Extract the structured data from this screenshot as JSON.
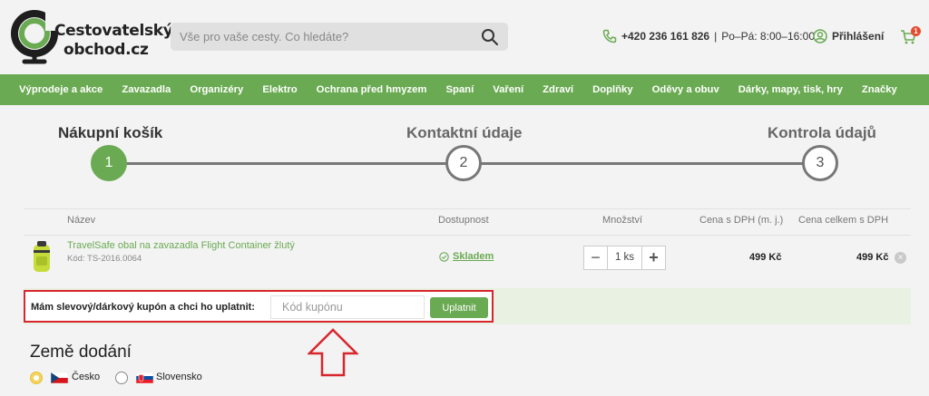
{
  "header": {
    "logo_line1": "Cestovatelský",
    "logo_line2": "obchod.cz",
    "search_placeholder": "Vše pro vaše cesty. Co hledáte?",
    "phone": "+420 236 161 826",
    "hours": "Po–Pá: 8:00–16:00",
    "login": "Přihlášení",
    "cart_count": "1"
  },
  "nav": {
    "items": [
      "Výprodeje a akce",
      "Zavazadla",
      "Organizéry",
      "Elektro",
      "Ochrana před hmyzem",
      "Spaní",
      "Vaření",
      "Zdraví",
      "Doplňky",
      "Oděvy a obuv",
      "Dárky, mapy, tisk, hry",
      "Značky"
    ]
  },
  "steps": [
    {
      "label": "Nákupní košík",
      "number": "1"
    },
    {
      "label": "Kontaktní údaje",
      "number": "2"
    },
    {
      "label": "Kontrola údajů",
      "number": "3"
    }
  ],
  "table": {
    "headers": {
      "name": "Název",
      "availability": "Dostupnost",
      "quantity": "Množství",
      "unit_price": "Cena s DPH (m. j.)",
      "total_price": "Cena celkem s DPH"
    },
    "item": {
      "name": "TravelSafe obal na zavazadla Flight Container žlutý",
      "code": "Kód: TS-2016.0064",
      "stock": "Skladem",
      "qty": "1 ks",
      "unit_price": "499 Kč",
      "total_price": "499 Kč"
    }
  },
  "coupon": {
    "label": "Mám slevový/dárkový kupón a chci ho uplatnit:",
    "placeholder": "Kód kupónu",
    "button": "Uplatnit"
  },
  "country": {
    "title": "Země dodání",
    "options": [
      "Česko",
      "Slovensko"
    ]
  },
  "colors": {
    "brand_green": "#6aaa52",
    "highlight_red": "#d8262c",
    "selected_yellow": "#f4d35e"
  }
}
